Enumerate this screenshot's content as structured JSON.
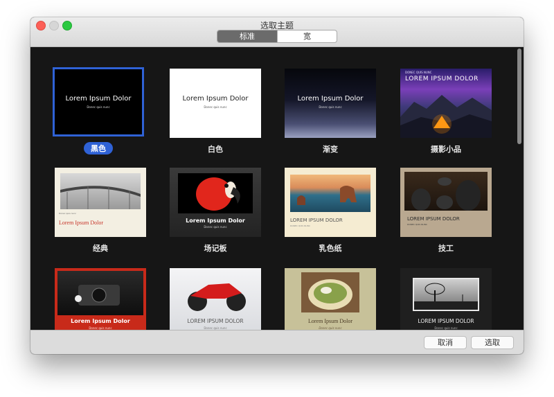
{
  "window": {
    "title": "选取主题"
  },
  "tabs": [
    {
      "label": "标准",
      "selected": true
    },
    {
      "label": "宽",
      "selected": false
    }
  ],
  "themes": [
    {
      "name": "黑色",
      "sample_title": "Lorem Ipsum Dolor",
      "sample_sub": "Donec quis nunc",
      "selected": true
    },
    {
      "name": "白色",
      "sample_title": "Lorem Ipsum Dolor",
      "sample_sub": "Donec quis nunc"
    },
    {
      "name": "渐变",
      "sample_title": "Lorem Ipsum Dolor",
      "sample_sub": "Donec quis nunc"
    },
    {
      "name": "摄影小品",
      "sample_title": "LOREM IPSUM DOLOR",
      "sample_sub": "DONEC QUIS NUNC"
    },
    {
      "name": "经典",
      "sample_title": "Lorem Ipsum Dolor",
      "sample_sub": "Donec quis nunc"
    },
    {
      "name": "场记板",
      "sample_title": "Lorem Ipsum Dolor",
      "sample_sub": "Donec quis nunc"
    },
    {
      "name": "乳色纸",
      "sample_title": "LOREM IPSUM DOLOR",
      "sample_sub": "DONEC QUIS NUNC"
    },
    {
      "name": "技工",
      "sample_title": "LOREM IPSUM DOLOR",
      "sample_sub": "DONEC QUIS NUNC"
    },
    {
      "name": "",
      "sample_title": "Lorem Ipsum Dolor",
      "sample_sub": "Donec quis nunc"
    },
    {
      "name": "",
      "sample_title": "LOREM IPSUM DOLOR",
      "sample_sub": "Donec quis nunc"
    },
    {
      "name": "",
      "sample_title": "Lorem Ipsum Dolor",
      "sample_sub": "Donec quis nunc"
    },
    {
      "name": "",
      "sample_title": "LOREM IPSUM DOLOR",
      "sample_sub": "Donec quis nunc"
    }
  ],
  "footer": {
    "cancel_label": "取消",
    "choose_label": "选取"
  },
  "colors": {
    "selection": "#2f62d6",
    "window_bg": "#161616"
  }
}
